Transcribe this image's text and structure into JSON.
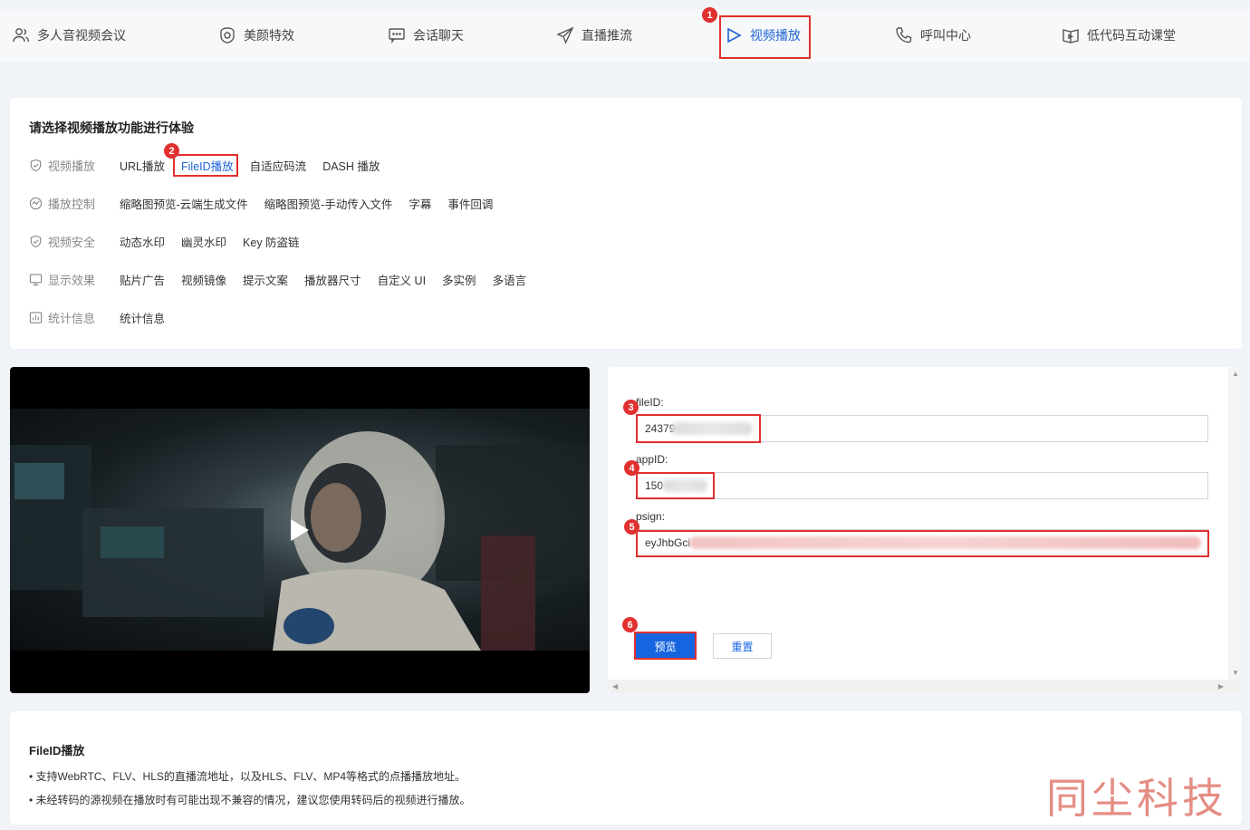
{
  "nav": {
    "items": [
      {
        "label": "多人音视频会议",
        "icon": "users-icon"
      },
      {
        "label": "美颜特效",
        "icon": "shield-face-icon"
      },
      {
        "label": "会话聊天",
        "icon": "chat-icon"
      },
      {
        "label": "直播推流",
        "icon": "send-icon"
      },
      {
        "label": "视频播放",
        "icon": "play-icon",
        "active": true
      },
      {
        "label": "呼叫中心",
        "icon": "phone-icon"
      },
      {
        "label": "低代码互动课堂",
        "icon": "book-play-icon"
      }
    ]
  },
  "badges": [
    "1",
    "2",
    "3",
    "4",
    "5",
    "6"
  ],
  "features": {
    "title": "请选择视频播放功能进行体验",
    "rows": [
      {
        "category": "视频播放",
        "icon": "shield-check-icon",
        "links": [
          "URL播放",
          "FileID播放",
          "自适应码流",
          "DASH 播放"
        ]
      },
      {
        "category": "播放控制",
        "icon": "control-icon",
        "links": [
          "缩略图预览-云端生成文件",
          "缩略图预览-手动传入文件",
          "字幕",
          "事件回调"
        ]
      },
      {
        "category": "视频安全",
        "icon": "shield-check-icon",
        "links": [
          "动态水印",
          "幽灵水印",
          "Key 防盗链"
        ]
      },
      {
        "category": "显示效果",
        "icon": "monitor-icon",
        "links": [
          "贴片广告",
          "视频镜像",
          "提示文案",
          "播放器尺寸",
          "自定义 UI",
          "多实例",
          "多语言"
        ]
      },
      {
        "category": "统计信息",
        "icon": "bar-chart-icon",
        "links": [
          "统计信息"
        ]
      }
    ]
  },
  "form": {
    "fileid_label": "fileID:",
    "fileid_value": "24379",
    "appid_label": "appID:",
    "appid_value": "150",
    "psign_label": "psign:",
    "psign_value": "eyJhbGci",
    "preview_label": "预览",
    "reset_label": "重置"
  },
  "info": {
    "title": "FileID播放",
    "lines": [
      "• 支持WebRTC、FLV、HLS的直播流地址，以及HLS、FLV、MP4等格式的点播播放地址。",
      "• 未经转码的源视频在播放时有可能出现不兼容的情况，建议您使用转码后的视频进行播放。"
    ]
  },
  "watermark": "同尘科技",
  "colors": {
    "accent": "#1665e0",
    "highlight": "#e0302f"
  }
}
